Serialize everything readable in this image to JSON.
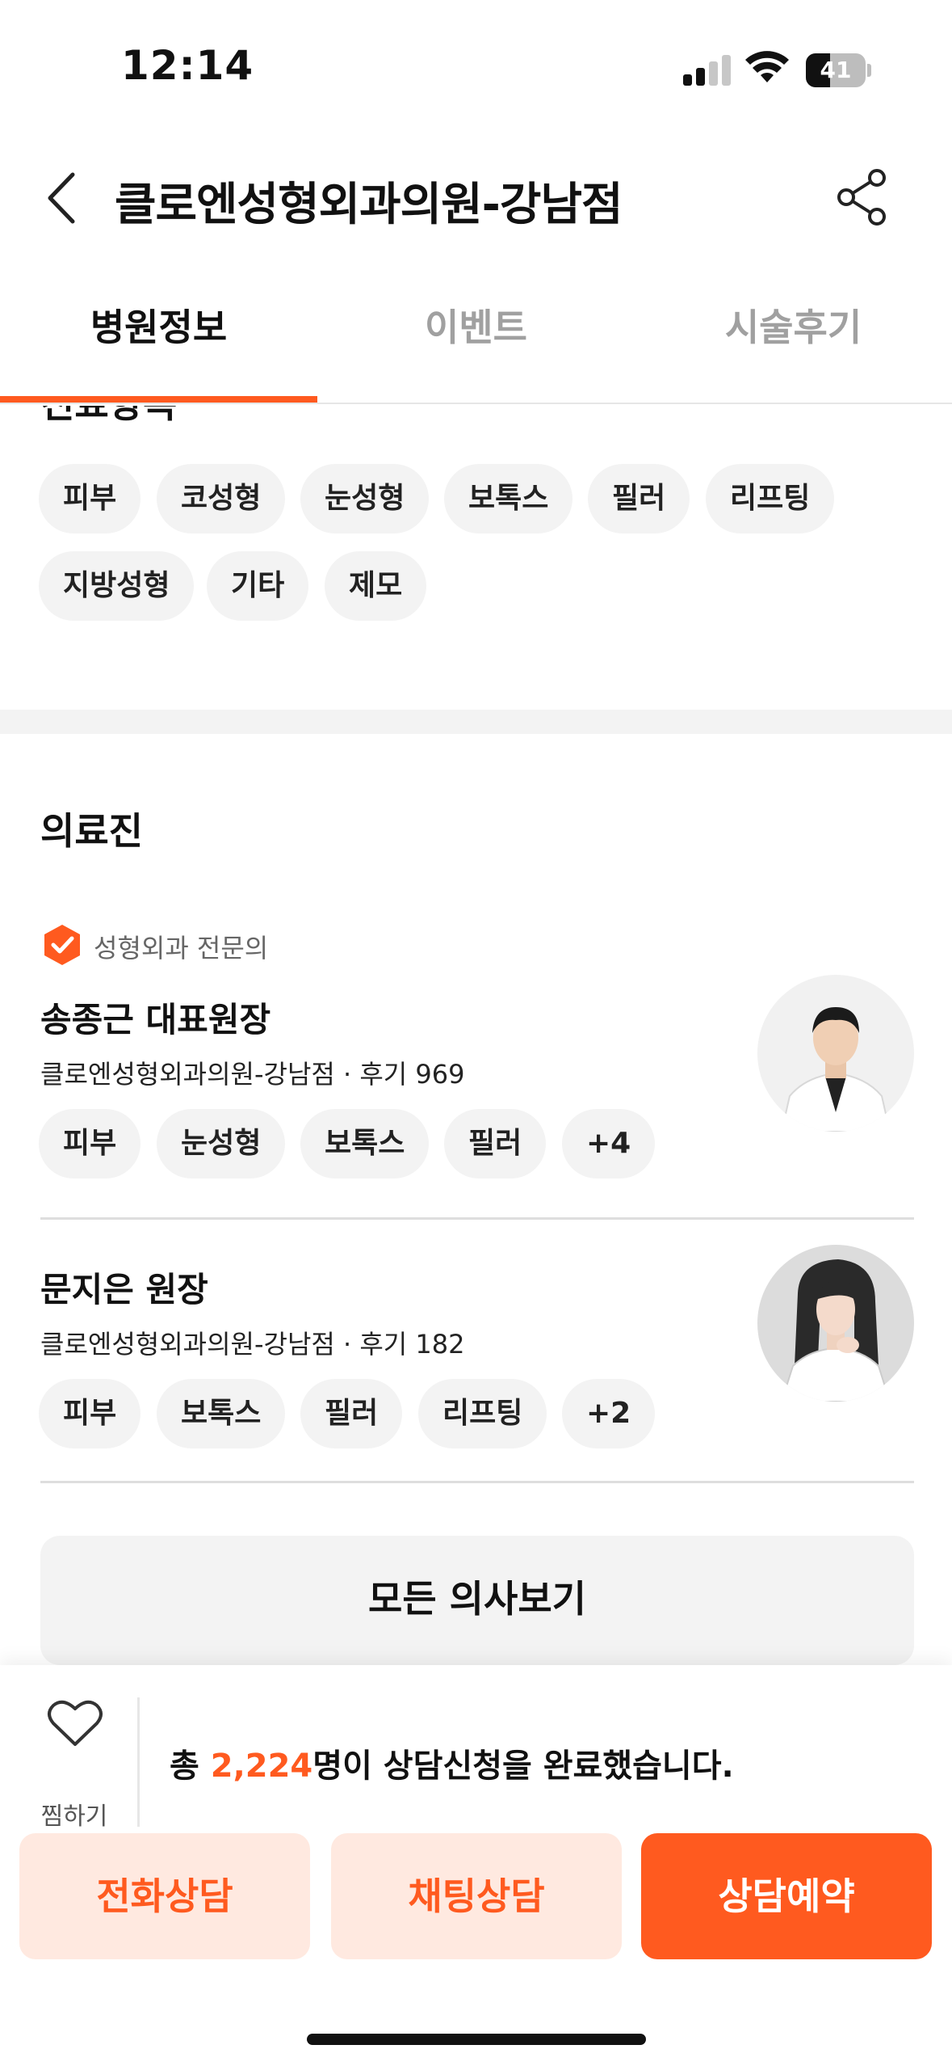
{
  "status_bar": {
    "time": "12:14",
    "battery": "41",
    "battery_level": 0.41
  },
  "header": {
    "title": "클로엔성형외과의원-강남점"
  },
  "tabs": [
    {
      "label": "병원정보",
      "active": true
    },
    {
      "label": "이벤트",
      "active": false
    },
    {
      "label": "시술후기",
      "active": false
    }
  ],
  "specialties": {
    "title": "진료항목",
    "items": [
      "피부",
      "코성형",
      "눈성형",
      "보톡스",
      "필러",
      "리프팅",
      "지방성형",
      "기타",
      "제모"
    ]
  },
  "medical_staff": {
    "title": "의료진",
    "doctors": [
      {
        "badge": "성형외과 전문의",
        "name": "송종근 대표원장",
        "info": "클로엔성형외과의원-강남점 · 후기 969",
        "tags": [
          "피부",
          "눈성형",
          "보톡스",
          "필러",
          "+4"
        ]
      },
      {
        "name": "문지은 원장",
        "info": "클로엔성형외과의원-강남점 · 후기 182",
        "tags": [
          "피부",
          "보톡스",
          "필러",
          "리프팅",
          "+2"
        ]
      }
    ],
    "all_button": "모든 의사보기"
  },
  "bottom_bar": {
    "wish_label": "찜하기",
    "consult_prefix": "총 ",
    "consult_count": "2,224",
    "consult_suffix": "명이 상담신청을 완료했습니다.",
    "buttons": {
      "phone": "전화상담",
      "chat": "채팅상담",
      "reserve": "상담예약"
    }
  },
  "colors": {
    "accent": "#ff5a1f",
    "accent_light": "#ffe9e0",
    "chip_bg": "#f3f3f3"
  },
  "icons": [
    "chevron-left-icon",
    "share-icon",
    "verified-badge-icon",
    "heart-icon",
    "signal-icon",
    "wifi-icon",
    "battery-icon"
  ]
}
